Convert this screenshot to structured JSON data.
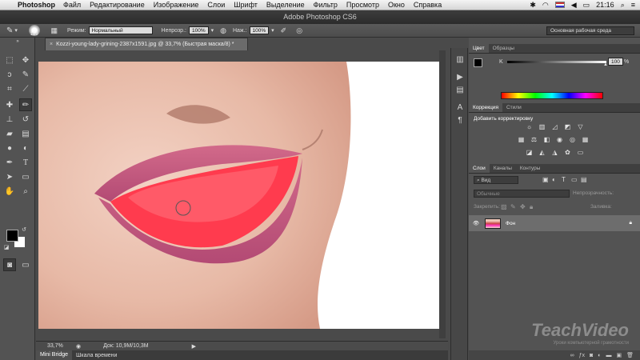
{
  "menubar": {
    "app": "Photoshop",
    "items": [
      "Файл",
      "Редактирование",
      "Изображение",
      "Слои",
      "Шрифт",
      "Выделение",
      "Фильтр",
      "Просмотр",
      "Окно",
      "Справка"
    ],
    "clock": "21:16"
  },
  "window_title": "Adobe Photoshop CS6",
  "options": {
    "brush_size": "119",
    "mode_label": "Режим:",
    "mode_value": "Нормальный",
    "opacity_label": "Непрозр.:",
    "opacity_value": "100%",
    "pressure_label": "Наж.:",
    "pressure_value": "100%",
    "workspace": "Основная рабочая среда"
  },
  "document": {
    "tab_title": "Kozzi-young-lady-grining-2387x1591.jpg @ 33,7% (Быстрая маска/8) *",
    "zoom": "33,7%",
    "doc_size": "Док: 10,9M/10,3M"
  },
  "bottom_tabs": [
    "Mini Bridge",
    "Шкала времени"
  ],
  "panels": {
    "color_tabs": [
      "Цвет",
      "Образцы"
    ],
    "k_label": "K",
    "k_value": "100",
    "k_unit": "%",
    "adj_tabs": [
      "Коррекция",
      "Стили"
    ],
    "adj_title": "Добавить корректировку",
    "layer_tabs": [
      "Слои",
      "Каналы",
      "Контуры"
    ],
    "kind_filter": "Вид",
    "blend_mode": "Обычные",
    "opacity_label": "Непрозрачность:",
    "lock_label": "Закрепить:",
    "fill_label": "Заливка:",
    "layer_name": "Фон"
  },
  "watermark": {
    "brand": "TeachVideo",
    "tagline": "Уроки компьютерной грамотности"
  },
  "colors": {
    "quick_mask": "#ff3b4e",
    "foreground": "#000000",
    "background": "#ffffff"
  }
}
